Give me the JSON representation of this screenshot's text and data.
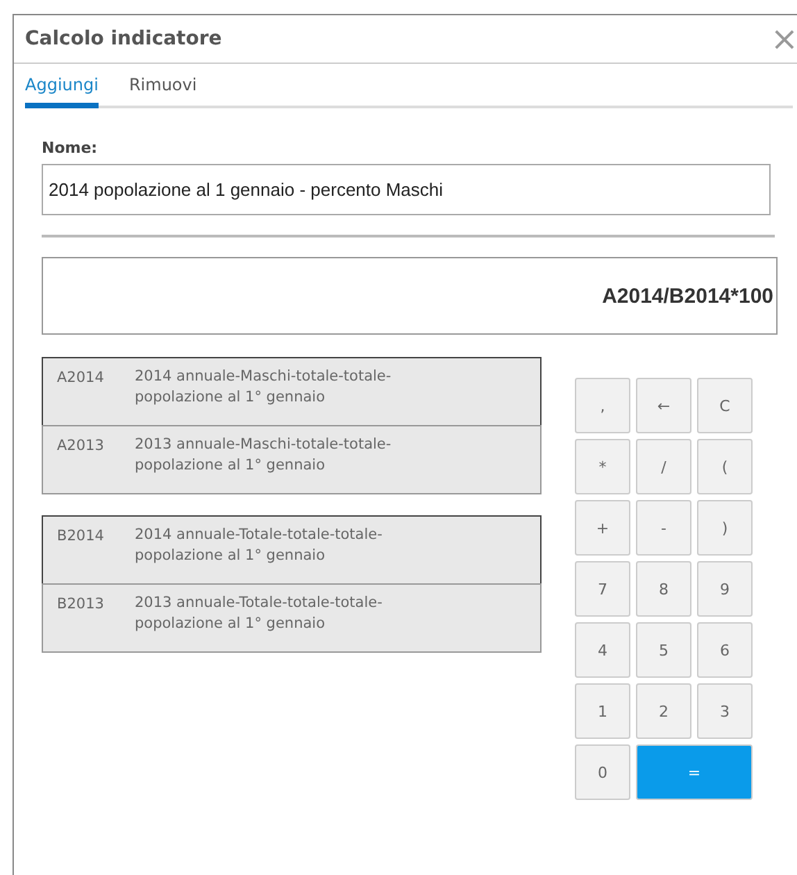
{
  "window": {
    "title": "Calcolo indicatore",
    "close": "×"
  },
  "tabs": [
    {
      "label": "Aggiungi",
      "selected": true
    },
    {
      "label": "Rimuovi",
      "selected": false
    }
  ],
  "name_field": {
    "label": "Nome:",
    "value": "2014 popolazione al 1 gennaio - percento Maschi"
  },
  "formula": "A2014/B2014*100",
  "groups": [
    {
      "rows": [
        {
          "code": "A2014",
          "description": "2014 annuale-Maschi-totale-totale-popolazione al 1° gennaio",
          "selected": true
        },
        {
          "code": "A2013",
          "description": "2013 annuale-Maschi-totale-totale-popolazione al 1° gennaio",
          "selected": false
        }
      ]
    },
    {
      "rows": [
        {
          "code": "B2014",
          "description": "2014 annuale-Totale-totale-totale-popolazione al 1° gennaio",
          "selected": true
        },
        {
          "code": "B2013",
          "description": "2013 annuale-Totale-totale-totale-popolazione al 1° gennaio",
          "selected": false
        }
      ]
    }
  ],
  "keypad": [
    {
      "label": ",",
      "kind": "key"
    },
    {
      "label": "←",
      "kind": "key"
    },
    {
      "label": "C",
      "kind": "key"
    },
    {
      "label": "*",
      "kind": "key"
    },
    {
      "label": "/",
      "kind": "key"
    },
    {
      "label": "(",
      "kind": "key"
    },
    {
      "label": "+",
      "kind": "key"
    },
    {
      "label": "-",
      "kind": "key"
    },
    {
      "label": ")",
      "kind": "key"
    },
    {
      "label": "7",
      "kind": "key"
    },
    {
      "label": "8",
      "kind": "key"
    },
    {
      "label": "9",
      "kind": "key"
    },
    {
      "label": "4",
      "kind": "key"
    },
    {
      "label": "5",
      "kind": "key"
    },
    {
      "label": "6",
      "kind": "key"
    },
    {
      "label": "1",
      "kind": "key"
    },
    {
      "label": "2",
      "kind": "key"
    },
    {
      "label": "3",
      "kind": "key"
    },
    {
      "label": "0",
      "kind": "key"
    },
    {
      "label": "=",
      "kind": "equals"
    }
  ]
}
